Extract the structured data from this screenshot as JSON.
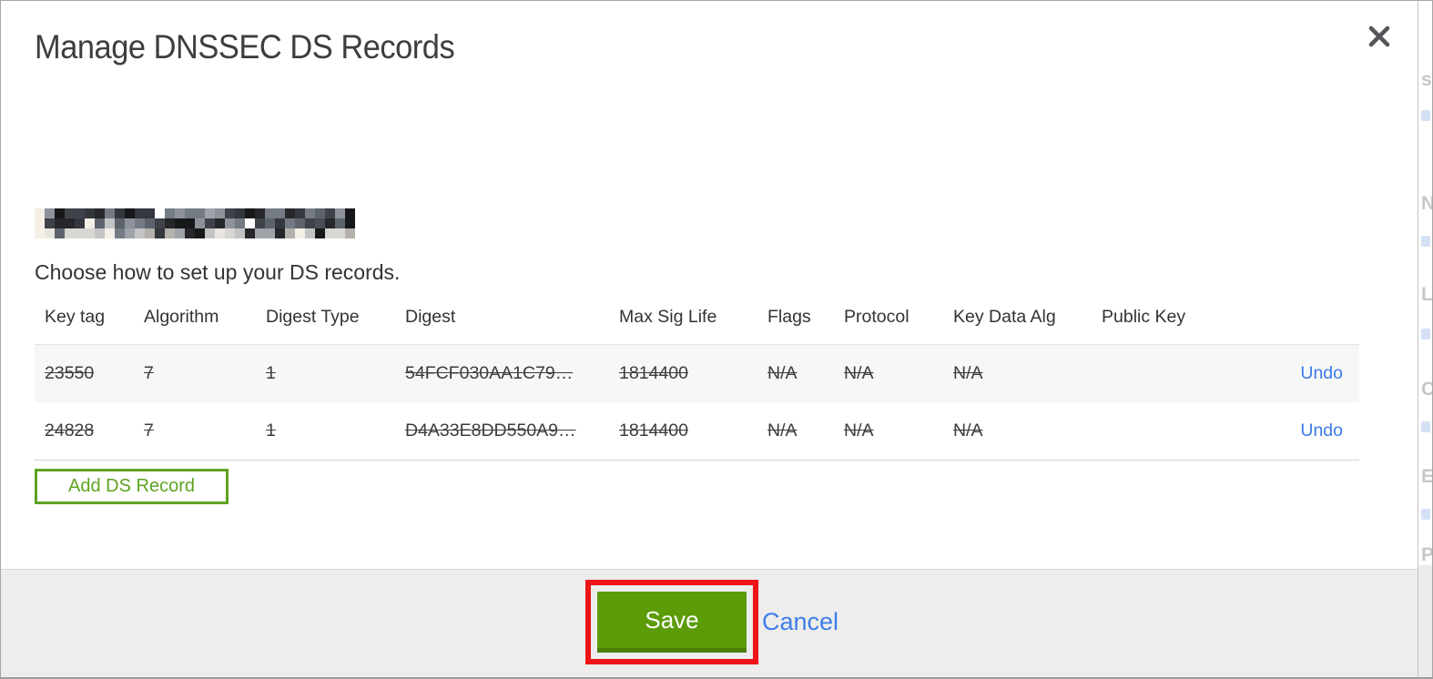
{
  "modal": {
    "title": "Manage DNSSEC DS Records",
    "domain_redacted": true,
    "instruction": "Choose how to set up your DS records.",
    "table": {
      "headers": {
        "key_tag": "Key tag",
        "algorithm": "Algorithm",
        "digest_type": "Digest Type",
        "digest": "Digest",
        "max_sig_life": "Max Sig Life",
        "flags": "Flags",
        "protocol": "Protocol",
        "key_data_alg": "Key Data Alg",
        "public_key": "Public Key"
      },
      "rows": [
        {
          "key_tag": "23550",
          "algorithm": "7",
          "digest_type": "1",
          "digest": "54FCF030AA1C79…",
          "max_sig_life": "1814400",
          "flags": "N/A",
          "protocol": "N/A",
          "key_data_alg": "N/A",
          "public_key": "",
          "action_label": "Undo",
          "struck_through": true
        },
        {
          "key_tag": "24828",
          "algorithm": "7",
          "digest_type": "1",
          "digest": "D4A33E8DD550A9…",
          "max_sig_life": "1814400",
          "flags": "N/A",
          "protocol": "N/A",
          "key_data_alg": "N/A",
          "public_key": "",
          "action_label": "Undo",
          "struck_through": true
        }
      ]
    },
    "add_record_button": "Add DS Record",
    "footer": {
      "save_button": "Save",
      "cancel_link": "Cancel"
    }
  },
  "annotation": {
    "highlight_color": "#ee1417",
    "target": "save-button"
  },
  "colors": {
    "save_green": "#5b9c08",
    "save_green_dark": "#4a7e05",
    "outline_green": "#5fa321",
    "link_blue": "#3c7bea",
    "cancel_blue": "#3e7de9",
    "footer_bg": "#ededed",
    "row_alt_bg": "#f7f7f7",
    "title_text": "#3e3e3e"
  },
  "redaction": {
    "palette_dark": [
      "#17181a",
      "#26272b",
      "#34373d",
      "#4a4e55",
      "#5d636c",
      "#757b85",
      "#8e939b",
      "#3f4248"
    ],
    "palette_light": [
      "#c3c4c6",
      "#d8d6d2",
      "#e9e5df",
      "#f4efe7",
      "#9ea3aa",
      "#b5b1ab"
    ]
  },
  "background_strip": {
    "fragments": [
      "s",
      "N",
      "L",
      "C",
      "E",
      "P"
    ]
  }
}
